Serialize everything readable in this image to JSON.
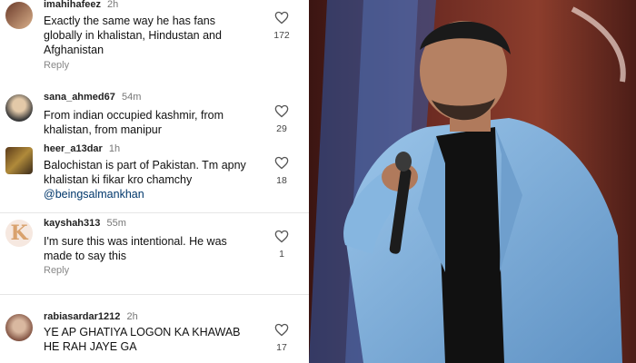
{
  "comments": [
    {
      "user": "imahihafeez",
      "time": "2h",
      "text": "Exactly the same way he has fans globally in khalistan, Hindustan and Afghanistan",
      "likes": "172",
      "reply_label": "Reply"
    },
    {
      "user": "sana_ahmed67",
      "time": "54m",
      "text": "From indian occupied kashmir, from khalistan, from manipur",
      "likes": "29"
    },
    {
      "user": "heer_a13dar",
      "time": "1h",
      "text": "Balochistan is part of Pakistan. Tm apny khalistan ki fikar kro chamchy",
      "mention": "@beingsalmankhan",
      "likes": "18"
    },
    {
      "user": "kayshah313",
      "time": "55m",
      "avatar_letter": "K",
      "text": "I'm sure this was intentional. He was made to say this",
      "likes": "1",
      "reply_label": "Reply"
    },
    {
      "user": "rabiasardar1212",
      "time": "2h",
      "text": "YE AP GHATIYA LOGON KA KHAWAB HE RAH JAYE GA",
      "likes": "17"
    }
  ],
  "colors": {
    "accent_blue": "#00376b",
    "jacket_blue": "#7fb0dc",
    "backdrop_red": "#7a3226"
  },
  "icons": {
    "like": "heart-outline-icon"
  }
}
